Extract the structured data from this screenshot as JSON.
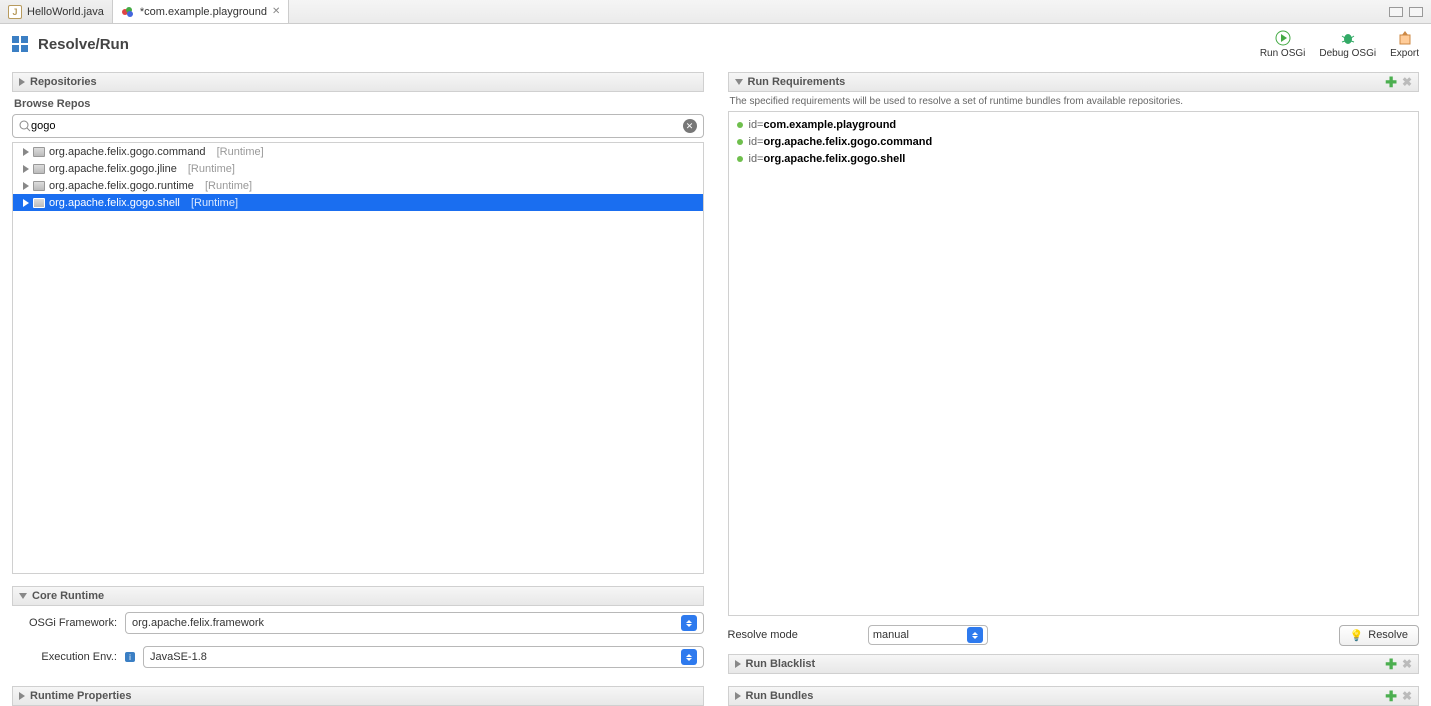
{
  "tabs": [
    {
      "label": "HelloWorld.java",
      "dirty": false
    },
    {
      "label": "*com.example.playground",
      "dirty": true
    }
  ],
  "header": {
    "title": "Resolve/Run"
  },
  "toolbar": {
    "runOsgi": "Run OSGi",
    "debugOsgi": "Debug OSGi",
    "export": "Export"
  },
  "left": {
    "repositories": {
      "title": "Repositories"
    },
    "browseLabel": "Browse Repos",
    "search": {
      "value": "gogo"
    },
    "treeItems": [
      {
        "name": "org.apache.felix.gogo.command",
        "tag": "[Runtime]",
        "selected": false
      },
      {
        "name": "org.apache.felix.gogo.jline",
        "tag": "[Runtime]",
        "selected": false
      },
      {
        "name": "org.apache.felix.gogo.runtime",
        "tag": "[Runtime]",
        "selected": false
      },
      {
        "name": "org.apache.felix.gogo.shell",
        "tag": "[Runtime]",
        "selected": true
      }
    ],
    "coreRuntime": {
      "title": "Core Runtime",
      "frameworkLabel": "OSGi Framework:",
      "frameworkValue": "org.apache.felix.framework",
      "envLabel": "Execution Env.:",
      "envValue": "JavaSE-1.8"
    },
    "runtimeProps": {
      "title": "Runtime Properties"
    }
  },
  "right": {
    "runReq": {
      "title": "Run Requirements",
      "desc": "The specified requirements will be used to resolve a set of runtime bundles from available repositories.",
      "items": [
        {
          "prefix": "id=",
          "name": "com.example.playground"
        },
        {
          "prefix": "id=",
          "name": "org.apache.felix.gogo.command"
        },
        {
          "prefix": "id=",
          "name": "org.apache.felix.gogo.shell"
        }
      ]
    },
    "resolveModeLabel": "Resolve mode",
    "resolveModeValue": "manual",
    "resolveBtn": "Resolve",
    "runBlacklist": {
      "title": "Run Blacklist"
    },
    "runBundles": {
      "title": "Run Bundles"
    }
  }
}
